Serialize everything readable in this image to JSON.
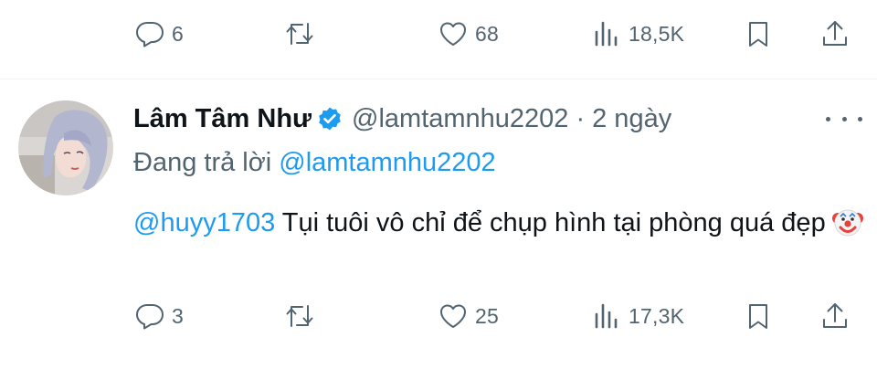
{
  "previous_tweet": {
    "actions": {
      "replies": "6",
      "retweets": "",
      "likes": "68",
      "views": "18,5K"
    }
  },
  "tweet": {
    "author_name": "Lâm Tâm Như",
    "handle": "@lamtamnhu2202",
    "separator": "·",
    "time": "2 ngày",
    "replying_label": "Đang trả lời",
    "replying_to": "@lamtamnhu2202",
    "text_mention": "@huyy1703",
    "text_body": " Tụi tuôi vô chỉ để chụp hình tại phòng quá đẹp",
    "emoji": "clown-face-emoji",
    "actions": {
      "replies": "3",
      "retweets": "",
      "likes": "25",
      "views": "17,3K"
    }
  },
  "colors": {
    "accent": "#1d9bf0",
    "secondary_text": "#536471",
    "primary_text": "#0f1419",
    "divider": "#eff3f4"
  },
  "icons": [
    "reply-icon",
    "retweet-icon",
    "like-icon",
    "views-icon",
    "bookmark-icon",
    "share-icon",
    "verified-badge-icon",
    "more-icon"
  ]
}
